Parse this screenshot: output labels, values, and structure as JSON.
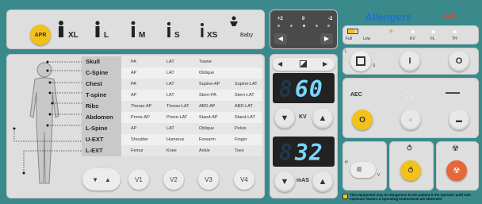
{
  "brand": "Allengers",
  "brand_suffix": "-HF",
  "body_sizes": {
    "apr": "APR",
    "xl": "XL",
    "l": "L",
    "m": "M",
    "s": "S",
    "xs": "XS",
    "baby": "Baby"
  },
  "density": {
    "plus2": "+2",
    "zero": "0",
    "minus2": "-2"
  },
  "status": {
    "full": "Full",
    "low": "Low",
    "kv": "KV",
    "fl": "FL",
    "th": "TH"
  },
  "anatomy": [
    {
      "label": "Skull",
      "cols": [
        "PA",
        "LAT",
        "Towne",
        ""
      ]
    },
    {
      "label": "C-Spine",
      "cols": [
        "AP",
        "LAT",
        "Oblique",
        ""
      ]
    },
    {
      "label": "Chest",
      "cols": [
        "PA",
        "LAT",
        "Supine-AP",
        "Supine-LAT"
      ]
    },
    {
      "label": "T-spine",
      "cols": [
        "AP",
        "LAT",
        "Stern-PA",
        "Stern-LAT"
      ]
    },
    {
      "label": "Ribs",
      "cols": [
        "Thorax-AP",
        "Thorax-LAT",
        "ABD-AP",
        "ABD-LAT"
      ]
    },
    {
      "label": "Abdomen",
      "cols": [
        "Prone-AP",
        "Prone-LAT",
        "Stand-AP",
        "Stand-LAT"
      ]
    },
    {
      "label": "L-Spine",
      "cols": [
        "AP",
        "LAT",
        "Oblique",
        "Pelvis"
      ]
    },
    {
      "label": "U-EXT",
      "cols": [
        "Shoulder",
        "Humerus",
        "Forearm",
        "Finger"
      ]
    },
    {
      "label": "L-EXT",
      "cols": [
        "Femur",
        "Knee",
        "Ankle",
        "Toes"
      ]
    }
  ],
  "views": {
    "v1": "V1",
    "v2": "V2",
    "v3": "V3",
    "v4": "V4"
  },
  "kv": {
    "display": "60",
    "label": "KV"
  },
  "mas": {
    "display": "32",
    "label": "mAS"
  },
  "aec": {
    "label": "AEC",
    "button": "O"
  },
  "workstation": {
    "l_label": "L",
    "s_label": "S",
    "standby": "I",
    "off": "O",
    "h_label": "H",
    "v_label": "V"
  },
  "warning": "This equipment may be dangerous to the patient & the operator until safe exposure factors & operating instructions are observed"
}
